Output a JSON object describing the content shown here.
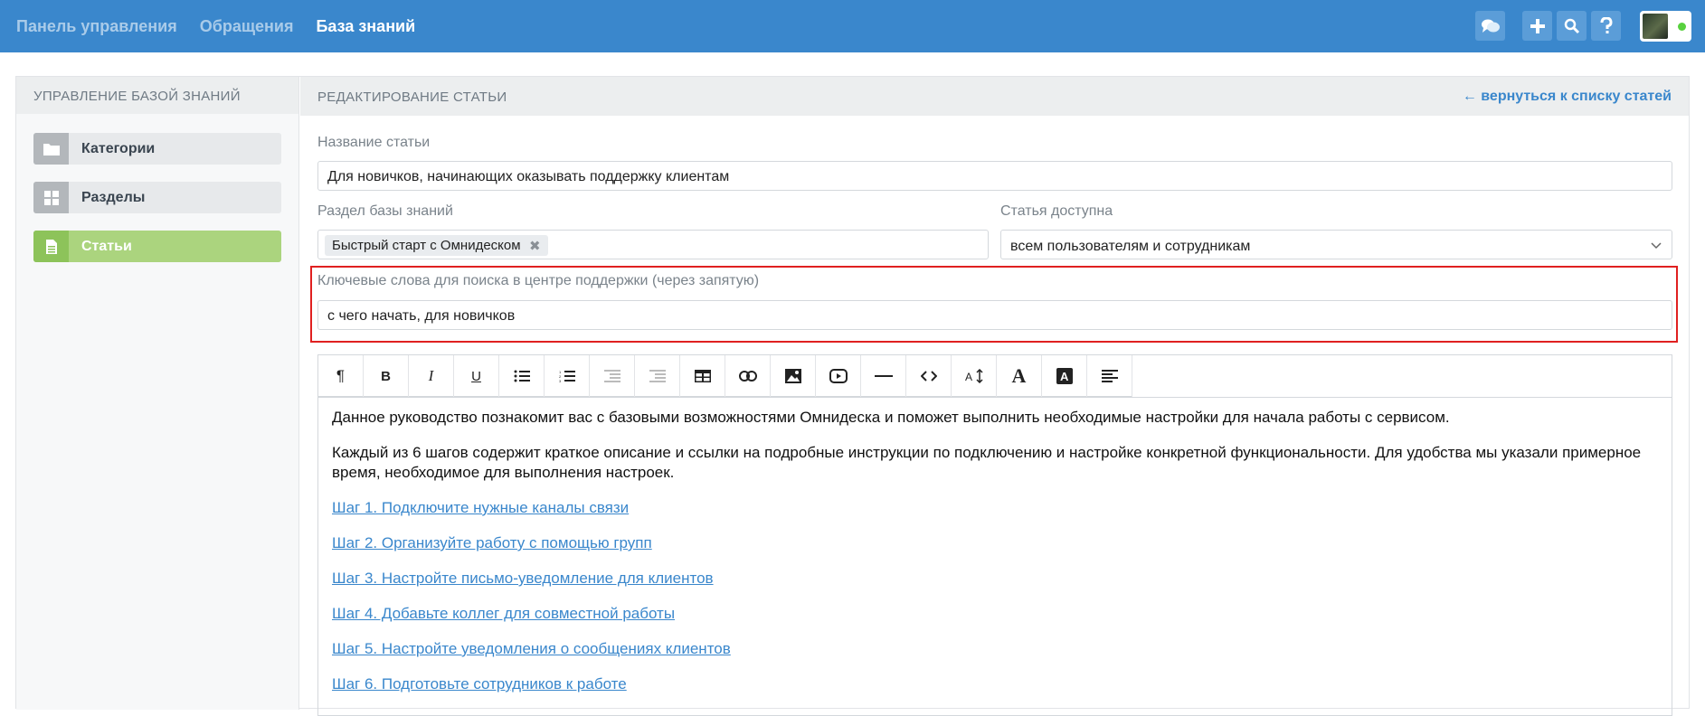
{
  "topnav": {
    "items": [
      {
        "label": "Панель управления",
        "active": false
      },
      {
        "label": "Обращения",
        "active": false
      },
      {
        "label": "База знаний",
        "active": true
      }
    ],
    "icons": [
      "chat-icon",
      "plus-icon",
      "search-icon",
      "help-icon"
    ]
  },
  "sidebar": {
    "title": "УПРАВЛЕНИЕ БАЗОЙ ЗНАНИЙ",
    "items": [
      {
        "label": "Категории",
        "icon": "folder-icon",
        "active": false
      },
      {
        "label": "Разделы",
        "icon": "grid-icon",
        "active": false
      },
      {
        "label": "Статьи",
        "icon": "document-icon",
        "active": true
      }
    ]
  },
  "main": {
    "title": "РЕДАКТИРОВАНИЕ СТАТЬИ",
    "back_link": "← вернуться к списку статей",
    "article_name_label": "Название статьи",
    "article_name_value": "Для новичков, начинающих оказывать поддержку клиентам",
    "section_label": "Раздел базы знаний",
    "section_tag": "Быстрый старт с Омнидеском",
    "access_label": "Статья доступна",
    "access_value": "всем пользователям и сотрудникам",
    "keywords_label": "Ключевые слова для поиска в центре поддержки (через запятую)",
    "keywords_value": "с чего начать, для новичков"
  },
  "editor": {
    "toolbar": [
      "¶",
      "B",
      "I",
      "U",
      "ul",
      "ol",
      "outdent",
      "indent",
      "table",
      "link",
      "image",
      "video",
      "hr",
      "code",
      "font-size",
      "A",
      "A-bg",
      "align"
    ],
    "paragraphs": [
      "Данное руководство познакомит вас с базовыми возможностями Омнидеска и поможет выполнить необходимые настройки для начала работы с сервисом.",
      "Каждый из 6 шагов содержит краткое описание и ссылки на подробные инструкции по подключению и настройке конкретной функциональности. Для удобства мы указали примерное время, необходимое для выполнения настроек."
    ],
    "links": [
      "Шаг 1. Подключите нужные каналы связи",
      "Шаг 2. Организуйте работу с помощью групп",
      "Шаг 3. Настройте письмо-уведомление для клиентов",
      "Шаг 4. Добавьте коллег для совместной работы",
      "Шаг 5. Настройте уведомления о сообщениях клиентов",
      "Шаг 6. Подготовьте сотрудников к работе"
    ]
  },
  "colors": {
    "topbar": "#3a87cc",
    "active_green": "#abd47e",
    "highlight": "#e02020",
    "link": "#3a87cc"
  }
}
